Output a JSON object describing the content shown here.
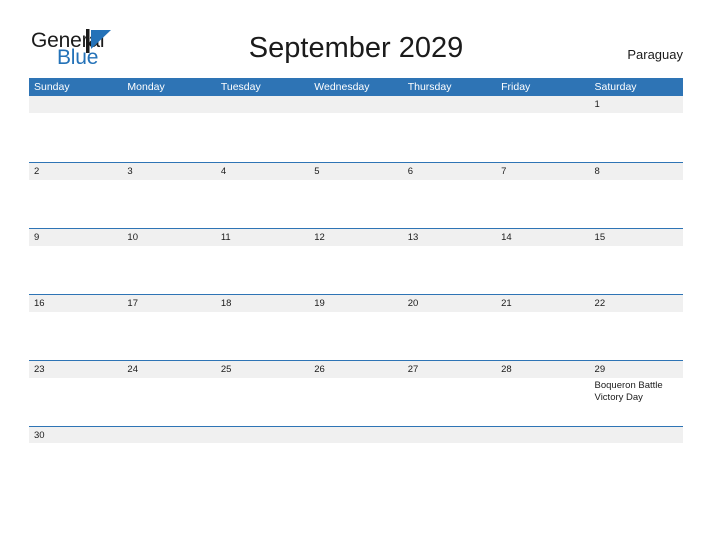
{
  "brand": {
    "word_one": "General",
    "word_two": "Blue",
    "mark_color": "#2472b8",
    "text_color": "#1b1b1b"
  },
  "header": {
    "title": "September 2029",
    "region": "Paraguay"
  },
  "theme": {
    "header_blue": "#2e74b5",
    "strip_gray": "#f0f0f0",
    "page_background": "#ffffff",
    "text": "#1b1b1b",
    "weekday_text": "#ffffff"
  },
  "calendar": {
    "weekdays": [
      "Sunday",
      "Monday",
      "Tuesday",
      "Wednesday",
      "Thursday",
      "Friday",
      "Saturday"
    ],
    "weeks": [
      {
        "days": [
          {
            "num": "",
            "events": []
          },
          {
            "num": "",
            "events": []
          },
          {
            "num": "",
            "events": []
          },
          {
            "num": "",
            "events": []
          },
          {
            "num": "",
            "events": []
          },
          {
            "num": "",
            "events": []
          },
          {
            "num": "1",
            "events": []
          }
        ]
      },
      {
        "days": [
          {
            "num": "2",
            "events": []
          },
          {
            "num": "3",
            "events": []
          },
          {
            "num": "4",
            "events": []
          },
          {
            "num": "5",
            "events": []
          },
          {
            "num": "6",
            "events": []
          },
          {
            "num": "7",
            "events": []
          },
          {
            "num": "8",
            "events": []
          }
        ]
      },
      {
        "days": [
          {
            "num": "9",
            "events": []
          },
          {
            "num": "10",
            "events": []
          },
          {
            "num": "11",
            "events": []
          },
          {
            "num": "12",
            "events": []
          },
          {
            "num": "13",
            "events": []
          },
          {
            "num": "14",
            "events": []
          },
          {
            "num": "15",
            "events": []
          }
        ]
      },
      {
        "days": [
          {
            "num": "16",
            "events": []
          },
          {
            "num": "17",
            "events": []
          },
          {
            "num": "18",
            "events": []
          },
          {
            "num": "19",
            "events": []
          },
          {
            "num": "20",
            "events": []
          },
          {
            "num": "21",
            "events": []
          },
          {
            "num": "22",
            "events": []
          }
        ]
      },
      {
        "days": [
          {
            "num": "23",
            "events": []
          },
          {
            "num": "24",
            "events": []
          },
          {
            "num": "25",
            "events": []
          },
          {
            "num": "26",
            "events": []
          },
          {
            "num": "27",
            "events": []
          },
          {
            "num": "28",
            "events": []
          },
          {
            "num": "29",
            "events": [
              "Boqueron Battle Victory Day"
            ]
          }
        ]
      },
      {
        "days": [
          {
            "num": "30",
            "events": []
          },
          {
            "num": "",
            "events": []
          },
          {
            "num": "",
            "events": []
          },
          {
            "num": "",
            "events": []
          },
          {
            "num": "",
            "events": []
          },
          {
            "num": "",
            "events": []
          },
          {
            "num": "",
            "events": []
          }
        ]
      }
    ]
  }
}
